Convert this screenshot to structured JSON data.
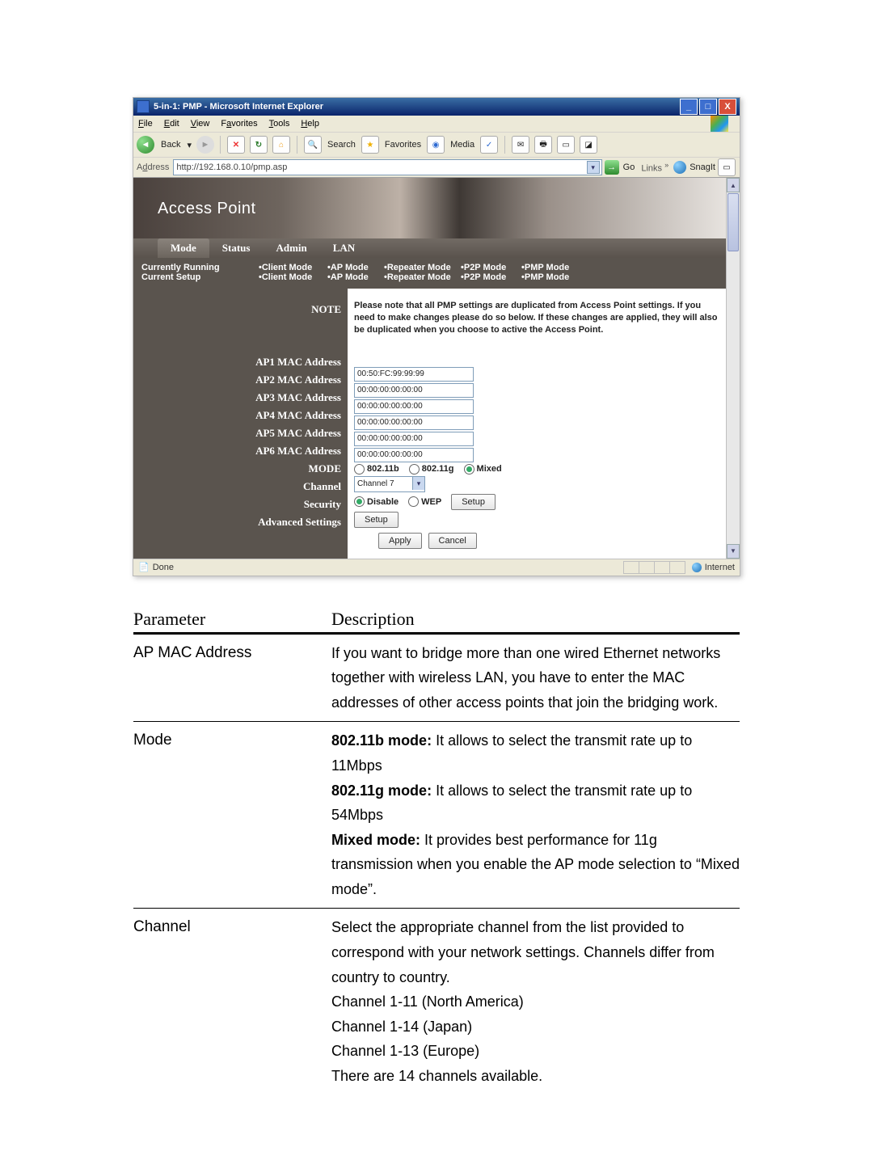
{
  "window": {
    "title": "5-in-1: PMP - Microsoft Internet Explorer",
    "menus": {
      "file": "File",
      "edit": "Edit",
      "view": "View",
      "favorites": "Favorites",
      "tools": "Tools",
      "help": "Help"
    },
    "toolbar": {
      "back": "Back",
      "search": "Search",
      "favorites": "Favorites",
      "media": "Media"
    },
    "address_label": "Address",
    "url": "http://192.168.0.10/pmp.asp",
    "go": "Go",
    "links": "Links",
    "snagit": "SnagIt"
  },
  "app": {
    "banner": "Access Point",
    "tabs": {
      "mode": "Mode",
      "status": "Status",
      "admin": "Admin",
      "lan": "LAN"
    },
    "sub": {
      "row1_label": "Currently Running",
      "row2_label": "Current Setup",
      "modes": {
        "client": "•Client Mode",
        "ap": "•AP Mode",
        "repeater": "•Repeater Mode",
        "p2p": "•P2P Mode",
        "pmp": "•PMP Mode"
      }
    },
    "note_label": "NOTE",
    "note_text": "Please note that all PMP settings are duplicated from Access Point settings. If you need to make changes please do so below. If these changes are applied, they will also be duplicated when you choose to active the Access Point.",
    "fields": {
      "ap1": {
        "label": "AP1 MAC Address",
        "value": "00:50:FC:99:99:99"
      },
      "ap2": {
        "label": "AP2 MAC Address",
        "value": "00:00:00:00:00:00"
      },
      "ap3": {
        "label": "AP3 MAC Address",
        "value": "00:00:00:00:00:00"
      },
      "ap4": {
        "label": "AP4 MAC Address",
        "value": "00:00:00:00:00:00"
      },
      "ap5": {
        "label": "AP5 MAC Address",
        "value": "00:00:00:00:00:00"
      },
      "ap6": {
        "label": "AP6 MAC Address",
        "value": "00:00:00:00:00:00"
      },
      "mode_label": "MODE",
      "mode_opts": {
        "b": "802.11b",
        "g": "802.11g",
        "mixed": "Mixed"
      },
      "channel_label": "Channel",
      "channel_value": "Channel 7",
      "security_label": "Security",
      "sec_disable": "Disable",
      "sec_wep": "WEP",
      "setup": "Setup",
      "adv_label": "Advanced Settings",
      "apply": "Apply",
      "cancel": "Cancel"
    }
  },
  "status": {
    "done": "Done",
    "zone": "Internet"
  },
  "table": {
    "h1": "Parameter",
    "h2": "Description",
    "r1": {
      "p": "AP MAC Address",
      "d": "If you want to bridge more than one wired Ethernet networks together with wireless LAN, you have to enter the MAC addresses of other access points that join the bridging work."
    },
    "r2": {
      "p": "Mode",
      "l1a": "802.11b mode:",
      "l1b": " It allows to select the transmit rate up to 11Mbps",
      "l2a": "802.11g mode:",
      "l2b": " It allows to select the transmit rate up to 54Mbps",
      "l3a": "Mixed mode:",
      "l3b": " It provides best performance for 11g transmission when you enable the AP mode selection to “Mixed mode”."
    },
    "r3": {
      "p": "Channel",
      "d1": "Select the appropriate channel from the list provided to correspond with your network settings. Channels differ from country to country.",
      "d2": "Channel 1-11 (North America)",
      "d3": "Channel 1-14 (Japan)",
      "d4": "Channel 1-13 (Europe)",
      "d5": "There are 14 channels available."
    }
  }
}
